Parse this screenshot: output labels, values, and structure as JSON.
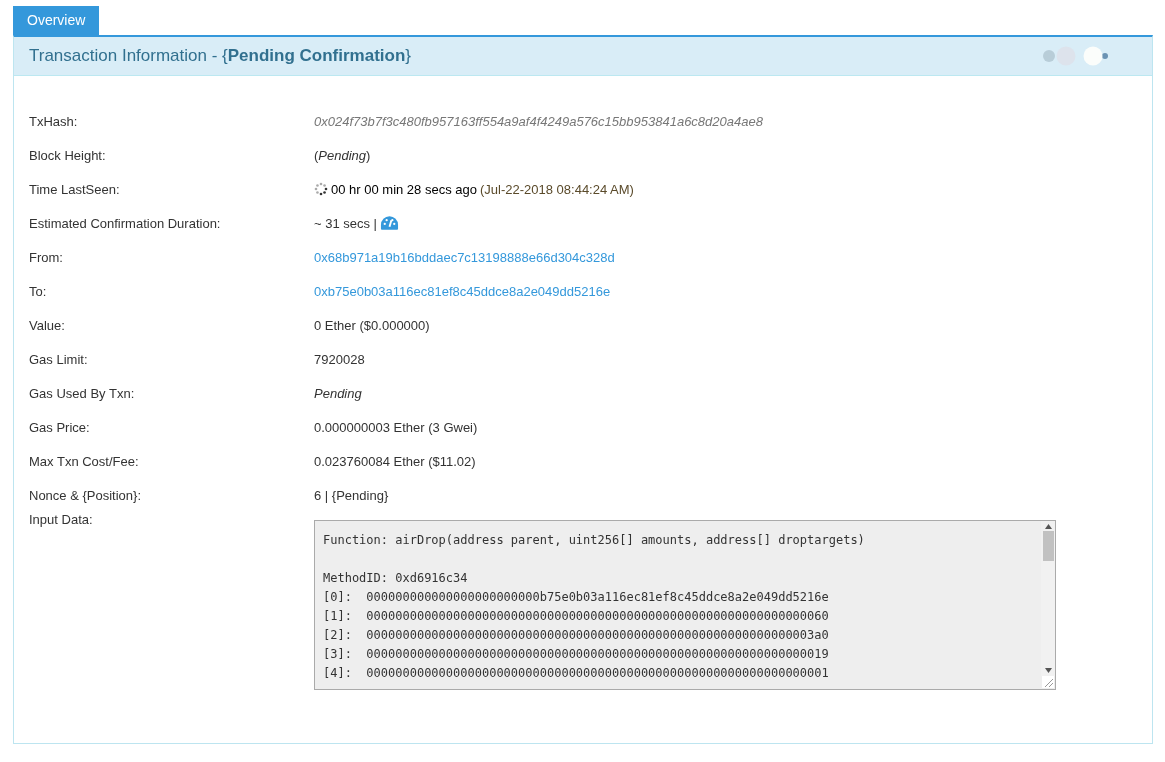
{
  "tabs": [
    {
      "label": "Overview",
      "selected": true
    }
  ],
  "panel": {
    "title": "Transaction Information - {**Pending Confirmation**}"
  },
  "rows": [
    {
      "label": "TxHash:",
      "kind": "hash",
      "value": "0x024f73b7f3c480fb957163ff554a9af4f4249a576c15bb953841a6c8d20a4ae8"
    },
    {
      "label": "Block Height:",
      "kind": "text",
      "value": "(*Pending*)"
    },
    {
      "label": "Time LastSeen:",
      "kind": "time",
      "value": "00 hr 00 min 28 secs ago",
      "note": "(Jul-22-2018 08:44:24 AM)"
    },
    {
      "label": "Estimated Confirmation Duration:",
      "kind": "duration",
      "value": "~ 31 secs |"
    },
    {
      "label": "From:",
      "kind": "link",
      "value": "0x68b971a19b16bddaec7c13198888e66d304c328d"
    },
    {
      "label": "To:",
      "kind": "link",
      "value": "0xb75e0b03a116ec81ef8c45ddce8a2e049dd5216e"
    },
    {
      "label": "Value:",
      "kind": "text",
      "value": "0 Ether ($0.000000)"
    },
    {
      "label": "Gas Limit:",
      "kind": "text",
      "value": "7920028"
    },
    {
      "label": "Gas Used By Txn:",
      "kind": "text",
      "value": "*Pending*"
    },
    {
      "label": "Gas Price:",
      "kind": "text",
      "value": "0.000000003 Ether (3 Gwei)"
    },
    {
      "label": "Max Txn Cost/Fee:",
      "kind": "text",
      "value": "0.023760084 Ether ($11.02)"
    },
    {
      "label": "Nonce & {Position}:",
      "kind": "text",
      "value": "6 | {Pending}"
    }
  ],
  "input_data": {
    "label": "Input Data:",
    "blocks": [
      [
        "Function: airDrop(address parent, uint256[] amounts, address[] droptargets)"
      ],
      [
        "MethodID: 0xd6916c34",
        "[0]:  000000000000000000000000b75e0b03a116ec81ef8c45ddce8a2e049dd5216e",
        "[1]:  0000000000000000000000000000000000000000000000000000000000000060",
        "[2]:  00000000000000000000000000000000000000000000000000000000000003a0",
        "[3]:  0000000000000000000000000000000000000000000000000000000000000019",
        "[4]:  0000000000000000000000000000000000000000000000000000000000000001"
      ]
    ]
  }
}
